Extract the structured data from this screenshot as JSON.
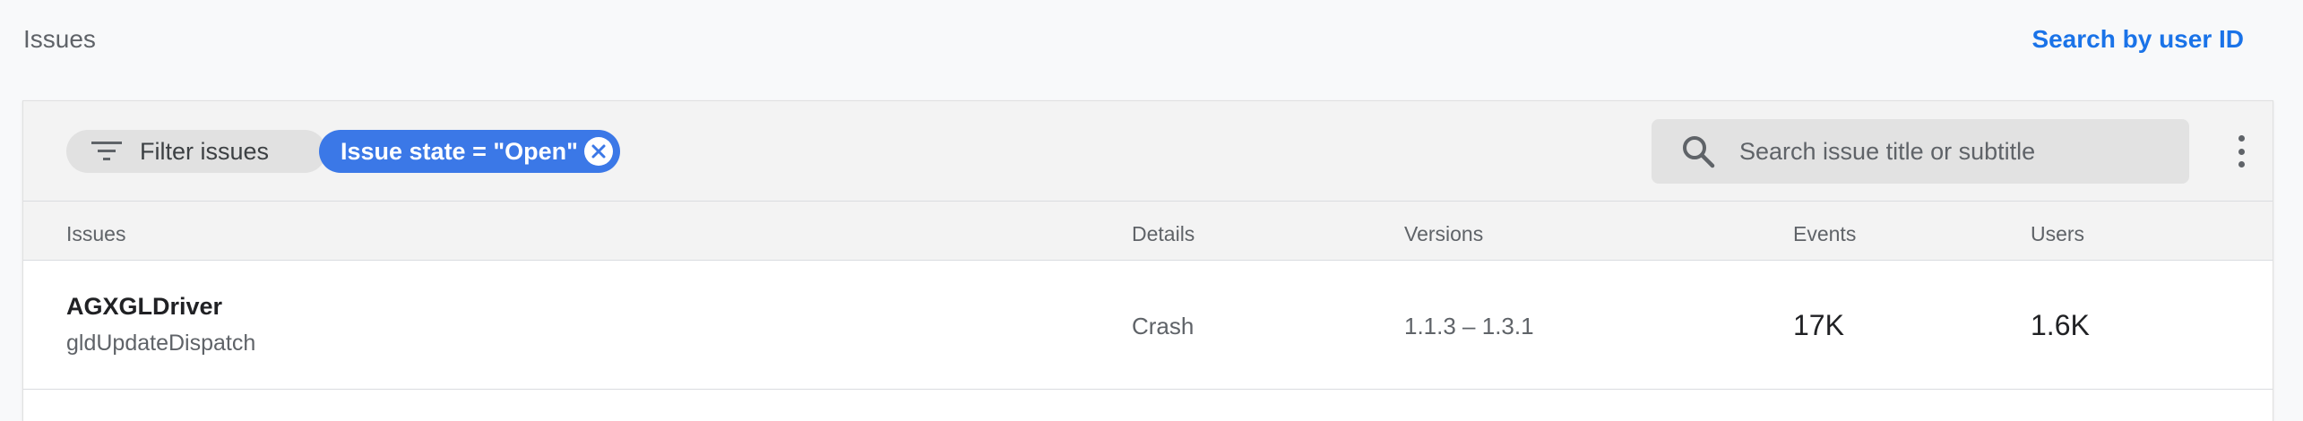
{
  "header": {
    "title": "Issues",
    "search_by_user_link": "Search by user ID"
  },
  "toolbar": {
    "filter_chip": {
      "label": "Filter issues",
      "icon": "filter-list-icon"
    },
    "state_chip": {
      "label": "Issue state = \"Open\"",
      "icon": "close-circle-icon"
    },
    "search": {
      "placeholder": "Search issue title or subtitle",
      "value": "",
      "icon": "search-icon"
    },
    "more_menu_icon": "more-vert-icon"
  },
  "table": {
    "columns": [
      "Issues",
      "Details",
      "Versions",
      "Events",
      "Users"
    ],
    "rows": [
      {
        "title": "AGXGLDriver",
        "subtitle": "gldUpdateDispatch",
        "details": "Crash",
        "versions": "1.1.3 – 1.3.1",
        "events": "17K",
        "users": "1.6K"
      }
    ]
  },
  "colors": {
    "accent": "#1a73e8",
    "chip_active": "#3b78e7",
    "chip_inactive": "#e1e1e1"
  }
}
